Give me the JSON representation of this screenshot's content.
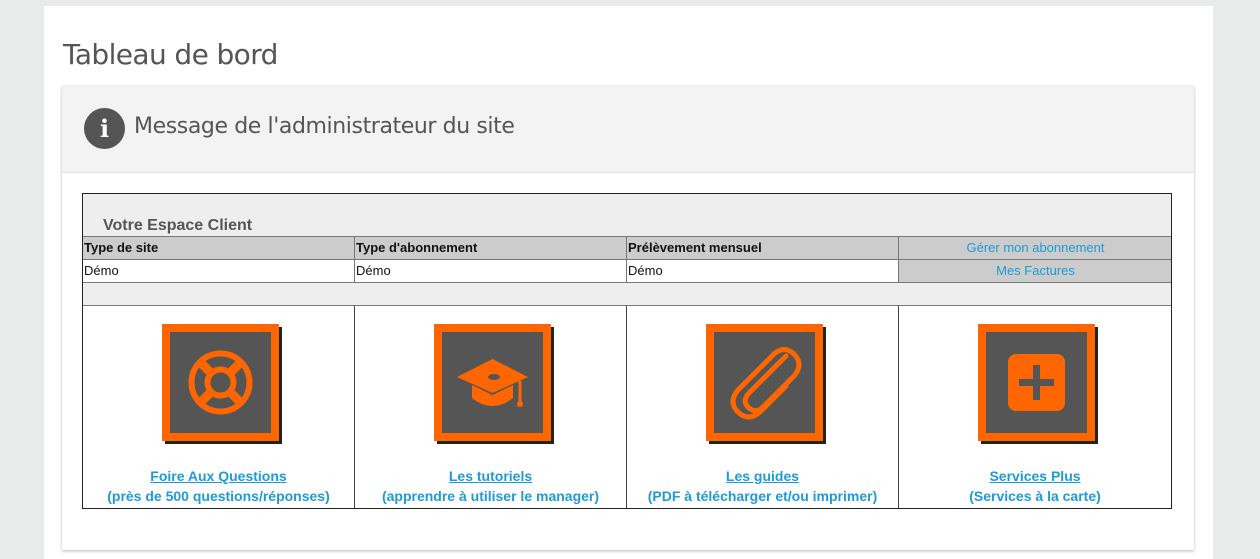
{
  "page": {
    "title": "Tableau de bord"
  },
  "admin_panel": {
    "title": "Message de l'administrateur du site"
  },
  "espace_client": {
    "title": "Votre Espace Client",
    "headers": [
      "Type de site",
      "Type d'abonnement",
      "Prélèvement mensuel"
    ],
    "values": [
      "Démo",
      "Démo",
      "Démo"
    ],
    "manage_link": "Gérer mon abonnement",
    "invoices_link": "Mes Factures"
  },
  "tiles": [
    {
      "label": "Foire Aux Questions",
      "sub": "(près de 500 questions/réponses)",
      "icon": "lifebuoy-icon"
    },
    {
      "label": "Les tutoriels",
      "sub": "(apprendre à utiliser le manager)",
      "icon": "graduation-cap-icon"
    },
    {
      "label": "Les guides",
      "sub": "(PDF à télécharger et/ou imprimer)",
      "icon": "paperclip-icon"
    },
    {
      "label": "Services Plus",
      "sub": "(Services à la carte)",
      "icon": "plus-square-icon"
    }
  ],
  "colors": {
    "accent": "#ff6600",
    "link": "#1e9bd6",
    "icon_bg": "#555555"
  }
}
